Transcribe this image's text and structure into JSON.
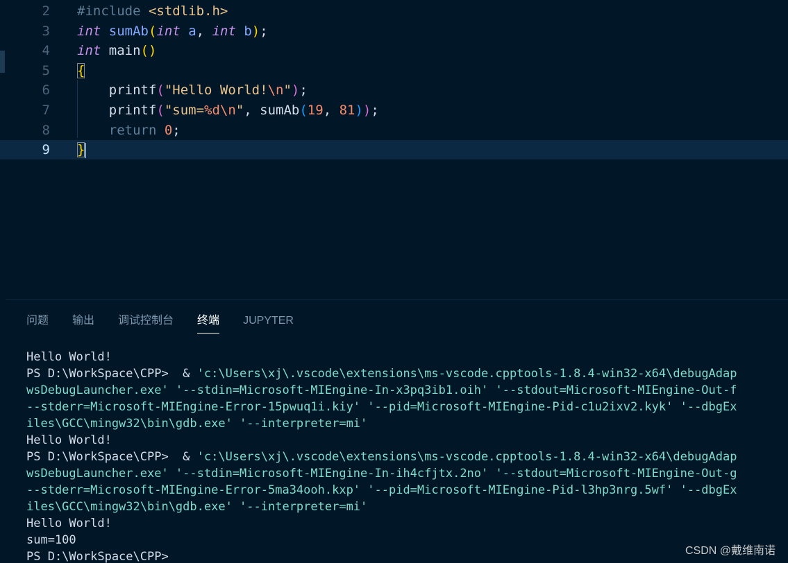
{
  "editor": {
    "lines": [
      {
        "num": "2",
        "tokens": [
          {
            "t": "#include ",
            "c": "t-pp"
          },
          {
            "t": "<stdlib.h>",
            "c": "t-inc"
          }
        ]
      },
      {
        "num": "3",
        "tokens": [
          {
            "t": "int",
            "c": "t-kw"
          },
          {
            "t": " ",
            "c": "t-pun"
          },
          {
            "t": "sumAb",
            "c": "t-fn"
          },
          {
            "t": "(",
            "c": "t-par"
          },
          {
            "t": "int",
            "c": "t-kw"
          },
          {
            "t": " ",
            "c": "t-pun"
          },
          {
            "t": "a",
            "c": "t-fn"
          },
          {
            "t": ", ",
            "c": "t-pun"
          },
          {
            "t": "int",
            "c": "t-kw"
          },
          {
            "t": " ",
            "c": "t-pun"
          },
          {
            "t": "b",
            "c": "t-fn"
          },
          {
            "t": ")",
            "c": "t-par"
          },
          {
            "t": ";",
            "c": "t-pun"
          }
        ]
      },
      {
        "num": "4",
        "tokens": [
          {
            "t": "int",
            "c": "t-kw"
          },
          {
            "t": " main",
            "c": "t-id"
          },
          {
            "t": "()",
            "c": "t-par"
          }
        ]
      },
      {
        "num": "5",
        "tokens": [
          {
            "t": "{",
            "c": "t-par",
            "box": true
          }
        ]
      },
      {
        "num": "6",
        "tokens": [
          {
            "t": "    printf",
            "c": "t-id"
          },
          {
            "t": "(",
            "c": "t-par2"
          },
          {
            "t": "\"Hello World!",
            "c": "t-str"
          },
          {
            "t": "\\n",
            "c": "t-esc"
          },
          {
            "t": "\"",
            "c": "t-str"
          },
          {
            "t": ")",
            "c": "t-par2"
          },
          {
            "t": ";",
            "c": "t-pun"
          }
        ]
      },
      {
        "num": "7",
        "tokens": [
          {
            "t": "    printf",
            "c": "t-id"
          },
          {
            "t": "(",
            "c": "t-par2"
          },
          {
            "t": "\"sum=",
            "c": "t-str"
          },
          {
            "t": "%d\\n",
            "c": "t-esc"
          },
          {
            "t": "\"",
            "c": "t-str"
          },
          {
            "t": ", sumAb",
            "c": "t-id"
          },
          {
            "t": "(",
            "c": "t-par3"
          },
          {
            "t": "19",
            "c": "t-num"
          },
          {
            "t": ", ",
            "c": "t-pun"
          },
          {
            "t": "81",
            "c": "t-num"
          },
          {
            "t": ")",
            "c": "t-par3"
          },
          {
            "t": ")",
            "c": "t-par2"
          },
          {
            "t": ";",
            "c": "t-pun"
          }
        ]
      },
      {
        "num": "8",
        "tokens": [
          {
            "t": "    return ",
            "c": "t-ret"
          },
          {
            "t": "0",
            "c": "t-num"
          },
          {
            "t": ";",
            "c": "t-pun"
          }
        ]
      },
      {
        "num": "9",
        "current": true,
        "tokens": [
          {
            "t": "}",
            "c": "t-par",
            "box": true
          }
        ]
      }
    ]
  },
  "panel": {
    "tabs": [
      {
        "label": "问题",
        "name": "tab-problems"
      },
      {
        "label": "输出",
        "name": "tab-output"
      },
      {
        "label": "调试控制台",
        "name": "tab-debug-console"
      },
      {
        "label": "终端",
        "name": "tab-terminal",
        "active": true
      },
      {
        "label": "JUPYTER",
        "name": "tab-jupyter"
      }
    ]
  },
  "terminal": {
    "lines": [
      [
        {
          "t": "Hello World!",
          "c": "c-white"
        }
      ],
      [
        {
          "t": "PS D:\\WorkSpace\\CPP>  & ",
          "c": "c-white"
        },
        {
          "t": "'c:\\Users\\xj\\.vscode\\extensions\\ms-vscode.cpptools-1.8.4-win32-x64\\debugAdap",
          "c": "c-str"
        }
      ],
      [
        {
          "t": "wsDebugLauncher.exe' '--stdin=Microsoft-MIEngine-In-x3pq3ib1.oih' '--stdout=Microsoft-MIEngine-Out-f",
          "c": "c-str"
        }
      ],
      [
        {
          "t": "--stderr=Microsoft-MIEngine-Error-15pwuq1i.kiy' '--pid=Microsoft-MIEngine-Pid-c1u2ixv2.kyk' '--dbgEx",
          "c": "c-str"
        }
      ],
      [
        {
          "t": "iles\\GCC\\mingw32\\bin\\gdb.exe' '--interpreter=mi'",
          "c": "c-str"
        }
      ],
      [
        {
          "t": "Hello World!",
          "c": "c-white"
        }
      ],
      [
        {
          "t": "PS D:\\WorkSpace\\CPP>  & ",
          "c": "c-white"
        },
        {
          "t": "'c:\\Users\\xj\\.vscode\\extensions\\ms-vscode.cpptools-1.8.4-win32-x64\\debugAdap",
          "c": "c-str"
        }
      ],
      [
        {
          "t": "wsDebugLauncher.exe' '--stdin=Microsoft-MIEngine-In-ih4cfjtx.2no' '--stdout=Microsoft-MIEngine-Out-g",
          "c": "c-str"
        }
      ],
      [
        {
          "t": "--stderr=Microsoft-MIEngine-Error-5ma34ooh.kxp' '--pid=Microsoft-MIEngine-Pid-l3hp3nrg.5wf' '--dbgEx",
          "c": "c-str"
        }
      ],
      [
        {
          "t": "iles\\GCC\\mingw32\\bin\\gdb.exe' '--interpreter=mi'",
          "c": "c-str"
        }
      ],
      [
        {
          "t": "Hello World!",
          "c": "c-white"
        }
      ],
      [
        {
          "t": "sum=100",
          "c": "c-white"
        }
      ],
      [
        {
          "t": "PS D:\\WorkSpace\\CPP>",
          "c": "c-white"
        }
      ]
    ]
  },
  "watermark": "CSDN @戴维南诺"
}
